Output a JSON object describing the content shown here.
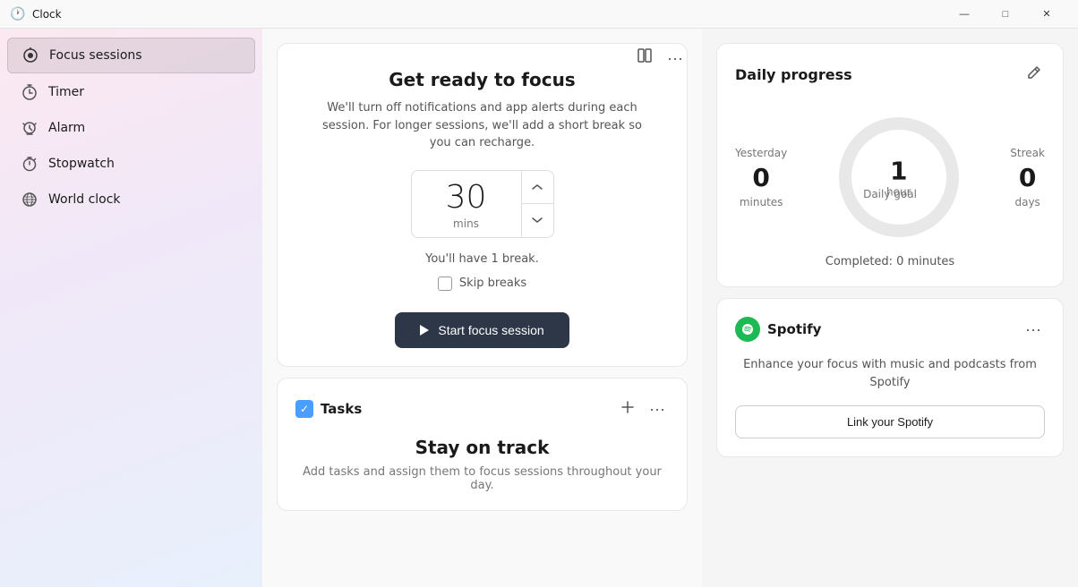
{
  "titleBar": {
    "icon": "🕐",
    "title": "Clock",
    "minimize": "—",
    "maximize": "□",
    "close": "✕"
  },
  "sidebar": {
    "items": [
      {
        "id": "focus-sessions",
        "label": "Focus sessions",
        "icon": "focus",
        "active": true
      },
      {
        "id": "timer",
        "label": "Timer",
        "icon": "timer",
        "active": false
      },
      {
        "id": "alarm",
        "label": "Alarm",
        "icon": "alarm",
        "active": false
      },
      {
        "id": "stopwatch",
        "label": "Stopwatch",
        "icon": "stopwatch",
        "active": false
      },
      {
        "id": "world-clock",
        "label": "World clock",
        "icon": "world",
        "active": false
      }
    ]
  },
  "focusCard": {
    "title": "Get ready to focus",
    "description": "We'll turn off notifications and app alerts during each session. For longer sessions, we'll add a short break so you can recharge.",
    "minutes": "30",
    "minsLabel": "mins",
    "breakInfo": "You'll have 1 break.",
    "skipBreaksLabel": "Skip breaks",
    "startButtonLabel": "Start focus session"
  },
  "tasksCard": {
    "title": "Tasks",
    "stayTitle": "Stay on track",
    "stayDesc": "Add tasks and assign them to focus sessions throughout your day."
  },
  "dailyProgress": {
    "title": "Daily progress",
    "yesterdayLabel": "Yesterday",
    "yesterdayValue": "0",
    "yesterdayUnit": "minutes",
    "dailyGoalLabel": "Daily goal",
    "dailyGoalValue": "1",
    "dailyGoalUnit": "hour",
    "streakLabel": "Streak",
    "streakValue": "0",
    "streakUnit": "days",
    "completedText": "Completed: 0 minutes"
  },
  "spotify": {
    "name": "Spotify",
    "description": "Enhance your focus with music and podcasts from Spotify",
    "linkButtonLabel": "Link your Spotify"
  }
}
